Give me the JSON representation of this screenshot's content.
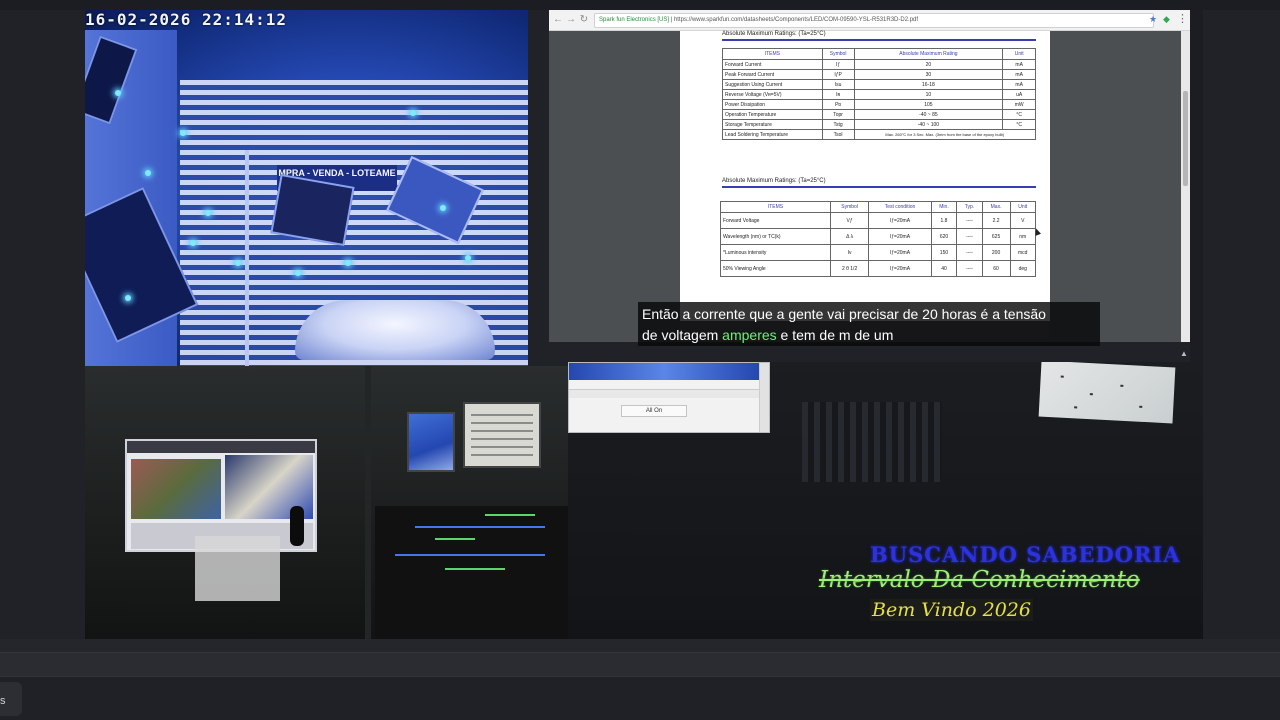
{
  "camera": {
    "timestamp": "16-02-2026  22:14:12",
    "sign_text": "MPRA - VENDA - LOTEAME"
  },
  "browser": {
    "url_secure_label": "Spark fun Electronics [US]",
    "url": "https://www.sparkfun.com/datasheets/Components/LED/COM-09590-YSL-R531R3D-D2.pdf",
    "menu_icon": "kebab-menu-icon"
  },
  "datasheet": {
    "section1_title": "Absolute Maximum Ratings:  (Ta=25°C)",
    "table1": {
      "headers": [
        "ITEMS",
        "Symbol",
        "Absolute Maximum Rating",
        "Unit"
      ],
      "rows": [
        [
          "Forward Current",
          "Iƒ",
          "20",
          "mA"
        ],
        [
          "Peak Forward Current",
          "IƒP",
          "30",
          "mA"
        ],
        [
          "Suggestion Using Current",
          "Isu",
          "16-18",
          "mA"
        ],
        [
          "Reverse Voltage    (Vʀ=5V)",
          "Iʀ",
          "10",
          "uA"
        ],
        [
          "Power Dissipation",
          "Pᴅ",
          "105",
          "mW"
        ],
        [
          "Operation Temperature",
          "Topr",
          "-40 ~ 85",
          "°C"
        ],
        [
          "Storage Temperature",
          "Tstg",
          "-40 ~ 100",
          "°C"
        ],
        [
          "Lead Soldering Temperature",
          "Tsol",
          "Max. 260°C for 3 Sec. Max.  (3mm from the base of the epoxy bulb)",
          ""
        ]
      ]
    },
    "section2_title": "Absolute Maximum Ratings:  (Ta=25°C)",
    "table2": {
      "headers": [
        "ITEMS",
        "Symbol",
        "Test condition",
        "Min.",
        "Typ.",
        "Max.",
        "Unit"
      ],
      "rows": [
        [
          "Forward Voltage",
          "Vƒ",
          "Iƒ=20mA",
          "1.8",
          "----",
          "2.2",
          "V"
        ],
        [
          "Wavelength (nm) or TC(k)",
          "Δ λ",
          "Iƒ=20mA",
          "620",
          "----",
          "625",
          "nm"
        ],
        [
          "*Luminous intensity",
          "Iv",
          "Iƒ=20mA",
          "150",
          "----",
          "200",
          "mcd"
        ],
        [
          "50% Viewing Angle",
          "2 θ 1/2",
          "Iƒ=20mA",
          "40",
          "----",
          "60",
          "deg"
        ]
      ]
    }
  },
  "caption": {
    "line1": "Então a corrente que a gente vai precisar de 20 horas é a tensão",
    "line2_prefix": "de voltagem ",
    "line2_highlight": "amperes",
    "line2_suffix": " e tem de m de um"
  },
  "popup": {
    "button_label": "All On"
  },
  "banner": {
    "line1": "BUSCANDO SABEDORIA",
    "line2": "Intervalo Da Conhecimento",
    "line3": "Bem Vindo 2026"
  },
  "footer": {
    "button_label": "s"
  },
  "colors": {
    "caption_highlight": "#6cf07c",
    "banner_blue": "#2d33d9",
    "banner_green": "#9ff07a",
    "banner_yellow": "#e4e046",
    "datasheet_accent": "#3a3fb0"
  }
}
